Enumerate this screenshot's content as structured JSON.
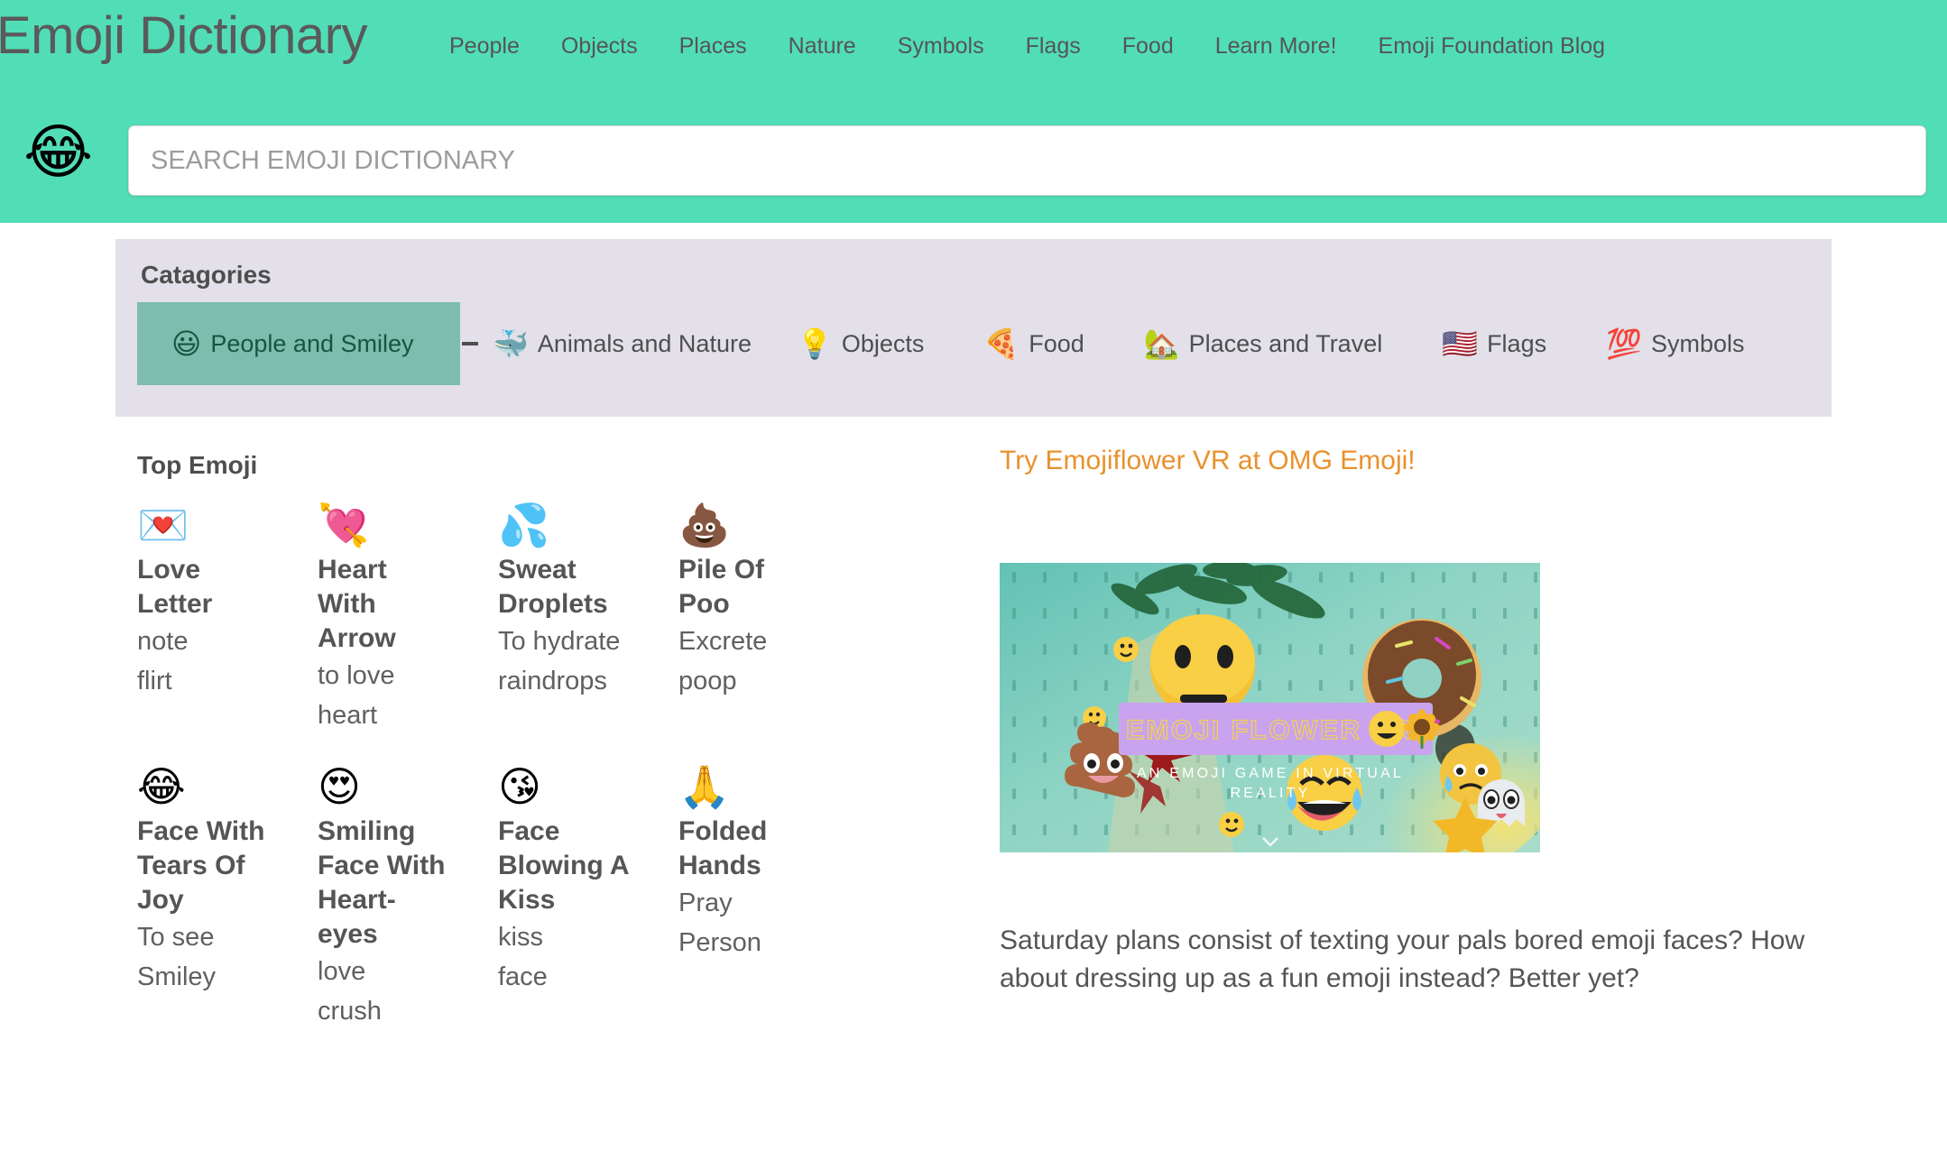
{
  "header": {
    "brand": "Emoji Dictionary",
    "nav": [
      {
        "label": "People"
      },
      {
        "label": "Objects"
      },
      {
        "label": "Places"
      },
      {
        "label": "Nature"
      },
      {
        "label": "Symbols"
      },
      {
        "label": "Flags"
      },
      {
        "label": "Food"
      },
      {
        "label": "Learn More!"
      },
      {
        "label": "Emoji Foundation Blog"
      }
    ],
    "brand_emoji": "😂",
    "brand_emoji_name": "face-with-tears-of-joy",
    "bg_color": "#51DEB7"
  },
  "search": {
    "placeholder": "SEARCH EMOJI DICTIONARY",
    "value": ""
  },
  "categories": {
    "title": "Catagories",
    "bg_color": "#E3E0EA",
    "active_color": "#7CBDAD",
    "items": [
      {
        "label": "People and Smiley",
        "emoji": "😃",
        "icon_name": "smiling-face-icon",
        "active": true
      },
      {
        "label": "Animals and Nature",
        "emoji": "🐳",
        "icon_name": "whale-icon",
        "active": false
      },
      {
        "label": "Objects",
        "emoji": "💡",
        "icon_name": "light-bulb-icon",
        "active": false
      },
      {
        "label": "Food",
        "emoji": "🍕",
        "icon_name": "pizza-icon",
        "active": false
      },
      {
        "label": "Places and Travel",
        "emoji": "🏡",
        "icon_name": "house-with-garden-icon",
        "active": false
      },
      {
        "label": "Flags",
        "emoji": "🇺🇸",
        "icon_name": "us-flag-icon",
        "active": false
      },
      {
        "label": "Symbols",
        "emoji": "💯",
        "icon_name": "hundred-points-icon",
        "active": false
      }
    ]
  },
  "top_emoji": {
    "title": "Top Emoji",
    "rows": [
      [
        {
          "emoji": "💌",
          "icon_name": "love-letter-icon",
          "name": "Love Letter",
          "keywords": [
            "note",
            "flirt"
          ]
        },
        {
          "emoji": "💘",
          "icon_name": "heart-with-arrow-icon",
          "name": "Heart With Arrow",
          "keywords": [
            "to love",
            "heart"
          ]
        },
        {
          "emoji": "💦",
          "icon_name": "sweat-droplets-icon",
          "name": "Sweat Droplets",
          "keywords": [
            "To hydrate",
            "raindrops"
          ]
        },
        {
          "emoji": "💩",
          "icon_name": "pile-of-poo-icon",
          "name": "Pile Of Poo",
          "keywords": [
            "Excrete",
            "poop"
          ]
        }
      ],
      [
        {
          "emoji": "😂",
          "icon_name": "face-with-tears-of-joy-icon",
          "name": "Face With Tears Of Joy",
          "keywords": [
            "To see",
            "Smiley"
          ]
        },
        {
          "emoji": "😍",
          "icon_name": "smiling-face-with-heart-eyes-icon",
          "name": "Smiling Face With Heart-eyes",
          "keywords": [
            "love",
            "crush"
          ]
        },
        {
          "emoji": "😘",
          "icon_name": "face-blowing-a-kiss-icon",
          "name": "Face Blowing A Kiss",
          "keywords": [
            "kiss",
            "face"
          ]
        },
        {
          "emoji": "🙏",
          "icon_name": "folded-hands-icon",
          "name": "Folded Hands",
          "keywords": [
            "Pray",
            "Person"
          ]
        }
      ]
    ]
  },
  "promo": {
    "link_text": "Try Emojiflower VR at OMG Emoji!",
    "link_color": "#E8912C",
    "banner_title": "EMOJI FLOWER  VR",
    "banner_subtitle": "AN EMOJI GAME IN VIRTUAL REALITY",
    "banner_title_bg": "#C9A3EE",
    "paragraph": "Saturday plans consist of texting your pals bored emoji faces? How about dressing up as a fun emoji instead? Better yet?"
  }
}
